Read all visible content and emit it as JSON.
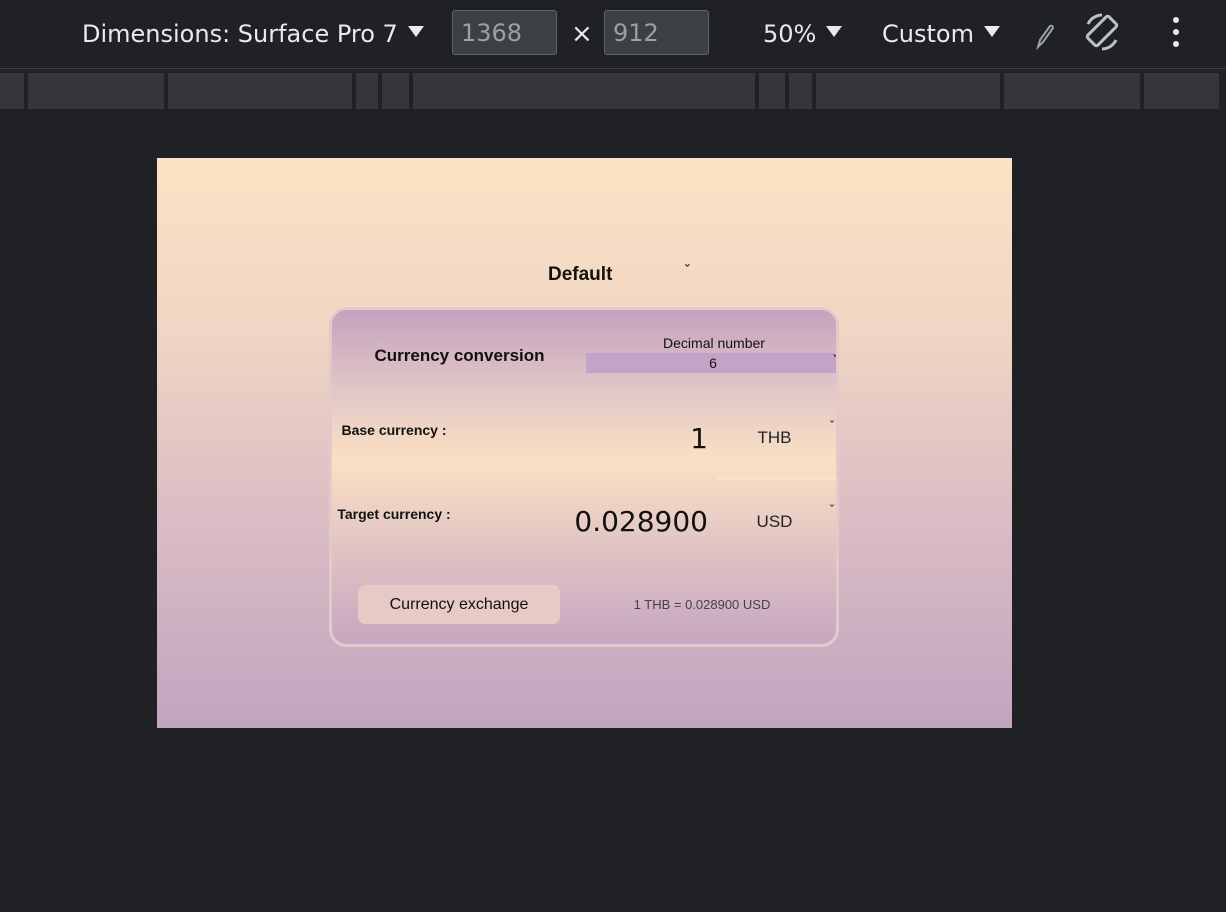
{
  "toolbar": {
    "dimensions_label": "Dimensions: Surface Pro 7",
    "width_value": "1368",
    "height_value": "912",
    "times_symbol": "×",
    "zoom_label": "50%",
    "throttle_label": "Custom"
  },
  "page": {
    "preset_select": "Default",
    "card": {
      "title": "Currency conversion",
      "decimal_label": "Decimal number",
      "decimal_value": "6",
      "base_label": "Base currency :",
      "base_amount": "1",
      "base_currency": "THB",
      "target_label": "Target currency :",
      "target_amount": "0.028900",
      "target_currency": "USD",
      "exchange_button": "Currency exchange",
      "rate_text": "1 THB = 0.028900 USD"
    },
    "chevron": "ˇ"
  },
  "colors": {
    "devtools_bg": "#202124",
    "gradient_top": "#fde2c4",
    "gradient_bottom": "#c2a4c0",
    "select_bg": "#c3a3c7"
  }
}
